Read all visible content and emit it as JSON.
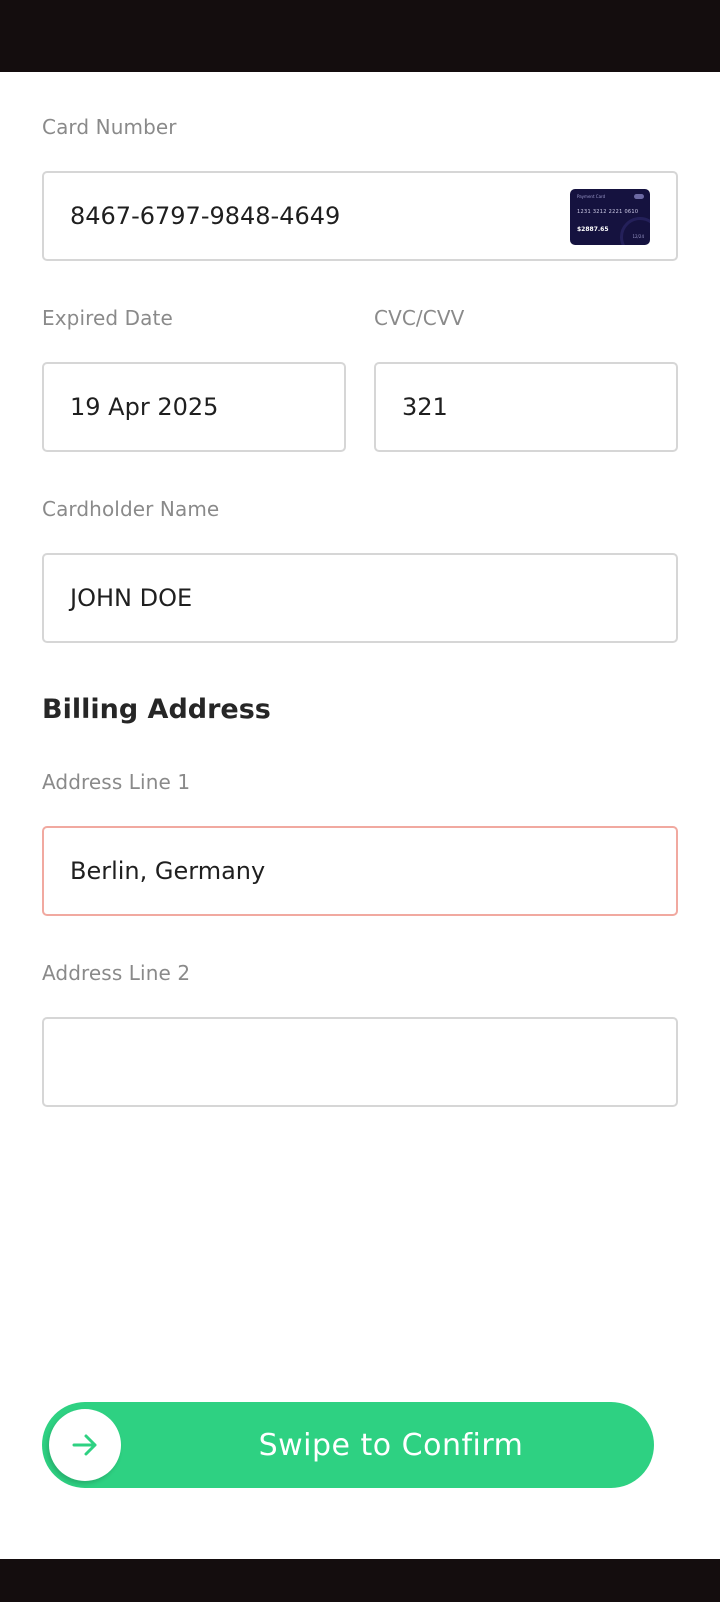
{
  "card_number": {
    "label": "Card Number",
    "value": "8467-6797-9848-4649",
    "thumbnail": {
      "top_text": "Payment Card",
      "number": "1231 3212 2221 0610",
      "amount": "$2887.65",
      "expiry": "12/24"
    }
  },
  "expired_date": {
    "label": "Expired Date",
    "value": "19 Apr 2025"
  },
  "cvc": {
    "label": "CVC/CVV",
    "value": "321"
  },
  "cardholder": {
    "label": "Cardholder Name",
    "value": "JOHN DOE"
  },
  "billing": {
    "title": "Billing Address",
    "address1": {
      "label": "Address Line 1",
      "value": "Berlin, Germany"
    },
    "address2": {
      "label": "Address Line 2",
      "value": ""
    }
  },
  "swipe": {
    "label": "Swipe to Confirm",
    "icon": "arrow-right-icon"
  },
  "colors": {
    "accent": "#2ed182",
    "error_border": "#f1a9a0",
    "system_bars": "#140d0e",
    "card": "#15123f"
  }
}
